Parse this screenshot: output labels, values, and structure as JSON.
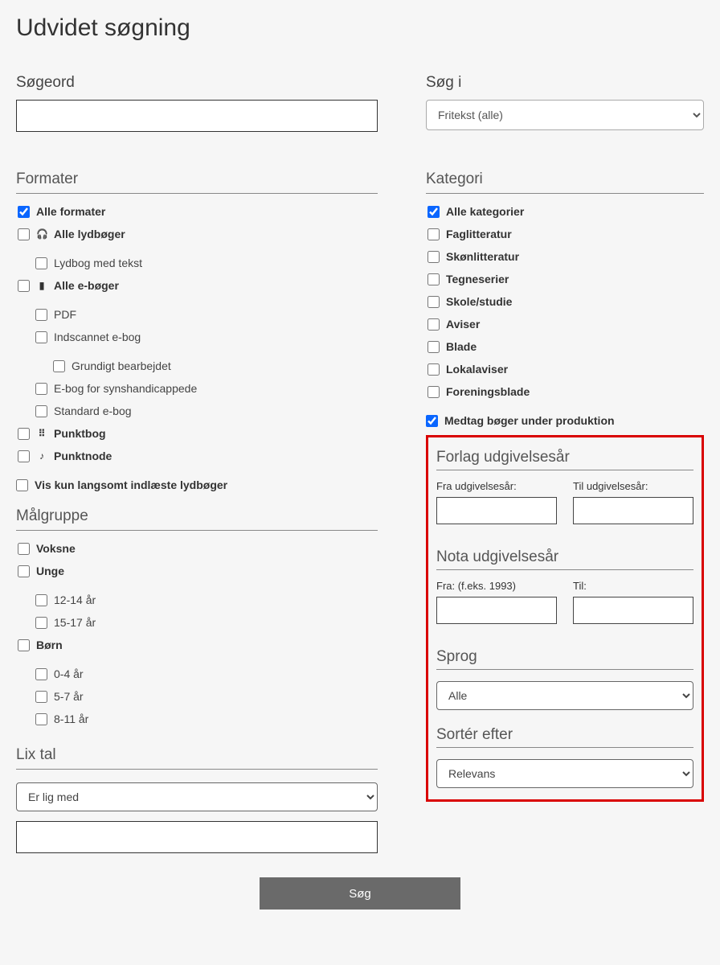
{
  "title": "Udvidet søgning",
  "search": {
    "label": "Søgeord",
    "value": ""
  },
  "searchIn": {
    "label": "Søg i",
    "selected": "Fritekst (alle)"
  },
  "formats": {
    "heading": "Formater",
    "items": [
      {
        "label": "Alle formater",
        "checked": true,
        "icon": ""
      },
      {
        "label": "Alle lydbøger",
        "checked": false,
        "icon": "headphones",
        "children": [
          {
            "label": "Lydbog med tekst",
            "checked": false
          }
        ]
      },
      {
        "label": "Alle e-bøger",
        "checked": false,
        "icon": "book",
        "children": [
          {
            "label": "PDF",
            "checked": false
          },
          {
            "label": "Indscannet e-bog",
            "checked": false,
            "children": [
              {
                "label": "Grundigt bearbejdet",
                "checked": false
              }
            ]
          },
          {
            "label": "E-bog for synshandicappede",
            "checked": false
          },
          {
            "label": "Standard e-bog",
            "checked": false
          }
        ]
      },
      {
        "label": "Punktbog",
        "checked": false,
        "icon": "braille"
      },
      {
        "label": "Punktnode",
        "checked": false,
        "icon": "note"
      }
    ],
    "slowLoad": {
      "label": "Vis kun langsomt indlæste lydbøger",
      "checked": false
    }
  },
  "audience": {
    "heading": "Målgruppe",
    "items": [
      {
        "label": "Voksne",
        "checked": false
      },
      {
        "label": "Unge",
        "checked": false,
        "children": [
          {
            "label": "12-14 år",
            "checked": false
          },
          {
            "label": "15-17 år",
            "checked": false
          }
        ]
      },
      {
        "label": "Børn",
        "checked": false,
        "children": [
          {
            "label": "0-4 år",
            "checked": false
          },
          {
            "label": "5-7 år",
            "checked": false
          },
          {
            "label": "8-11 år",
            "checked": false
          }
        ]
      }
    ]
  },
  "lix": {
    "heading": "Lix tal",
    "selected": "Er lig med",
    "value": ""
  },
  "category": {
    "heading": "Kategori",
    "items": [
      {
        "label": "Alle kategorier",
        "checked": true
      },
      {
        "label": "Faglitteratur",
        "checked": false
      },
      {
        "label": "Skønlitteratur",
        "checked": false
      },
      {
        "label": "Tegneserier",
        "checked": false
      },
      {
        "label": "Skole/studie",
        "checked": false
      },
      {
        "label": "Aviser",
        "checked": false
      },
      {
        "label": "Blade",
        "checked": false
      },
      {
        "label": "Lokalaviser",
        "checked": false
      },
      {
        "label": "Foreningsblade",
        "checked": false
      }
    ],
    "includeProduction": {
      "label": "Medtag bøger under produktion",
      "checked": true
    }
  },
  "publisherYear": {
    "heading": "Forlag udgivelsesår",
    "fromLabel": "Fra udgivelsesår:",
    "toLabel": "Til udgivelsesår:",
    "from": "",
    "to": ""
  },
  "notaYear": {
    "heading": "Nota udgivelsesår",
    "fromLabel": "Fra: (f.eks. 1993)",
    "toLabel": "Til:",
    "from": "",
    "to": ""
  },
  "language": {
    "heading": "Sprog",
    "selected": "Alle"
  },
  "sort": {
    "heading": "Sortér efter",
    "selected": "Relevans"
  },
  "submit": "Søg"
}
